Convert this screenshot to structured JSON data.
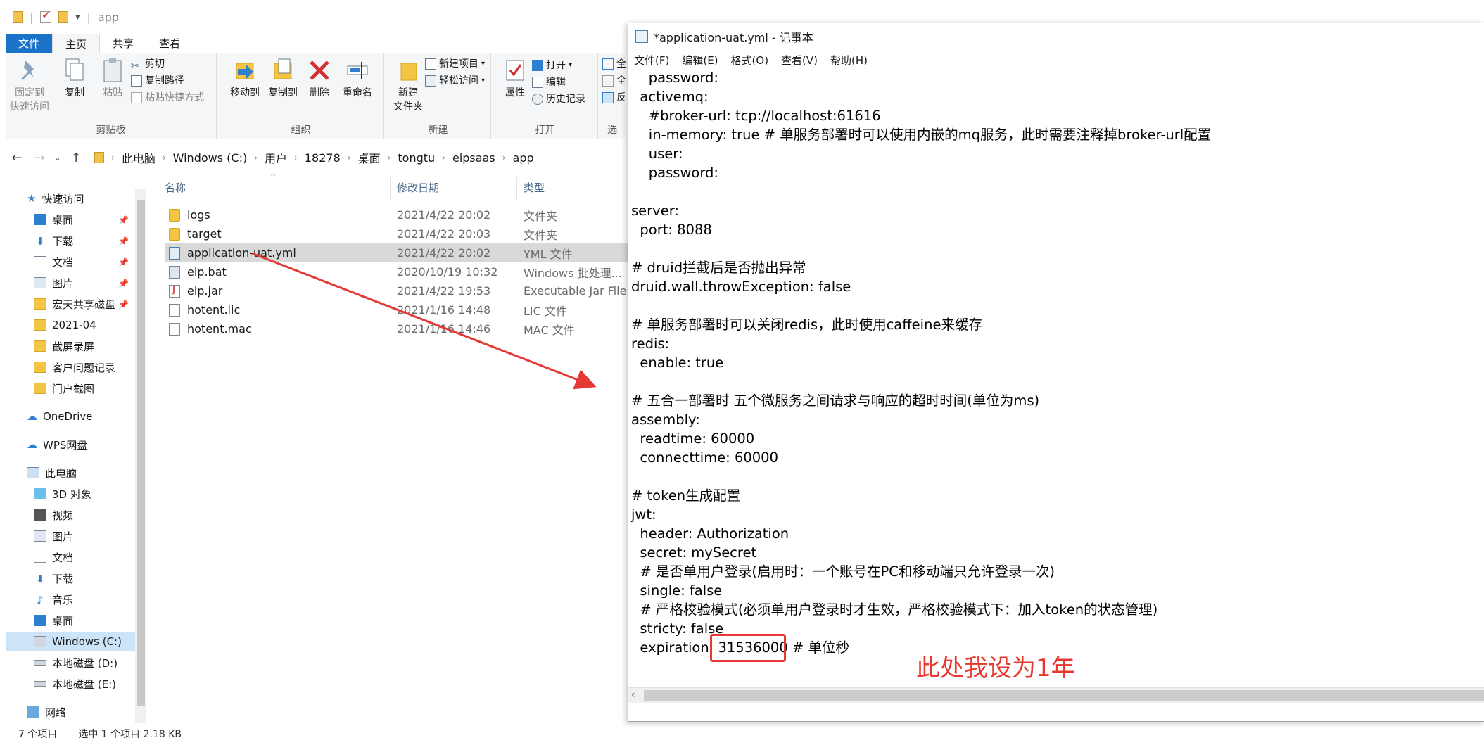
{
  "explorer": {
    "title": "app",
    "tabs": [
      {
        "label": "文件"
      },
      {
        "label": "主页"
      },
      {
        "label": "共享"
      },
      {
        "label": "查看"
      }
    ],
    "ribbon": {
      "clipboard": {
        "pin_label": "固定到\n快速访问",
        "copy_label": "复制",
        "paste_label": "粘贴",
        "cut_label": "剪切",
        "copy_path_label": "复制路径",
        "paste_shortcut_label": "粘贴快捷方式",
        "group_label": "剪贴板"
      },
      "organize": {
        "move_to_label": "移动到",
        "copy_to_label": "复制到",
        "delete_label": "删除",
        "rename_label": "重命名",
        "group_label": "组织"
      },
      "new": {
        "new_folder_label": "新建\n文件夹",
        "new_item_label": "新建项目",
        "easy_access_label": "轻松访问",
        "group_label": "新建"
      },
      "open": {
        "properties_label": "属性",
        "open_label": "打开",
        "edit_label": "编辑",
        "history_label": "历史记录",
        "group_label": "打开"
      },
      "select": {
        "all_label": "全",
        "none_label": "全",
        "invert_label": "反",
        "group_label": "选"
      }
    },
    "breadcrumb": [
      "此电脑",
      "Windows (C:)",
      "用户",
      "18278",
      "桌面",
      "tongtu",
      "eipsaas",
      "app"
    ],
    "nav": {
      "quick_access": "快速访问",
      "items_quick": [
        "桌面",
        "下载",
        "文档",
        "图片",
        "宏天共享磁盘",
        "2021-04",
        "截屏录屏",
        "客户问题记录",
        "门户截图"
      ],
      "onedrive": "OneDrive",
      "wps": "WPS网盘",
      "this_pc": "此电脑",
      "items_pc": [
        "3D 对象",
        "视频",
        "图片",
        "文档",
        "下载",
        "音乐",
        "桌面",
        "Windows (C:)",
        "本地磁盘 (D:)",
        "本地磁盘 (E:)"
      ],
      "network": "网络"
    },
    "columns": {
      "name": "名称",
      "date": "修改日期",
      "type": "类型"
    },
    "files": [
      {
        "name": "logs",
        "date": "2021/4/22 20:02",
        "type": "文件夹",
        "icon": "folder-icon"
      },
      {
        "name": "target",
        "date": "2021/4/22 20:03",
        "type": "文件夹",
        "icon": "folder-icon"
      },
      {
        "name": "application-uat.yml",
        "date": "2021/4/22 20:02",
        "type": "YML 文件",
        "icon": "yml-file-icon"
      },
      {
        "name": "eip.bat",
        "date": "2020/10/19 10:32",
        "type": "Windows 批处理...",
        "icon": "batch-file-icon"
      },
      {
        "name": "eip.jar",
        "date": "2021/4/22 19:53",
        "type": "Executable Jar File",
        "icon": "jar-file-icon"
      },
      {
        "name": "hotent.lic",
        "date": "2021/1/16 14:48",
        "type": "LIC 文件",
        "icon": "file-icon"
      },
      {
        "name": "hotent.mac",
        "date": "2021/1/16 14:46",
        "type": "MAC 文件",
        "icon": "file-icon"
      }
    ],
    "status": {
      "count": "7 个项目",
      "selected": "选中 1 个项目  2.18 KB"
    }
  },
  "notepad": {
    "title": "*application-uat.yml - 记事本",
    "menu": [
      "文件(F)",
      "编辑(E)",
      "格式(O)",
      "查看(V)",
      "帮助(H)"
    ],
    "lines": [
      "    password:",
      "  activemq:",
      "    #broker-url: tcp://localhost:61616",
      "    in-memory: true # 单服务部署时可以使用内嵌的mq服务，此时需要注释掉broker-url配置",
      "    user:",
      "    password:",
      "",
      "server:",
      "  port: 8088",
      "",
      "# druid拦截后是否抛出异常",
      "druid.wall.throwException: false",
      "",
      "# 单服务部署时可以关闭redis，此时使用caffeine来缓存",
      "redis:",
      "  enable: true",
      "",
      "# 五合一部署时 五个微服务之间请求与响应的超时时间(单位为ms)",
      "assembly:",
      "  readtime: 60000",
      "  connecttime: 60000",
      "",
      "# token生成配置",
      "jwt:",
      "  header: Authorization",
      "  secret: mySecret",
      "  # 是否单用户登录(启用时：一个账号在PC和移动端只允许登录一次)",
      "  single: false",
      "  # 严格校验模式(必须单用户登录时才生效，严格校验模式下：加入token的状态管理)",
      "  stricty: false",
      "  expiration: 31536000 # 单位秒"
    ],
    "annotation": "此处我设为1年"
  },
  "colors": {
    "accent": "#1a73c8",
    "highlight": "#e53935",
    "annotation": "#e8382e"
  }
}
